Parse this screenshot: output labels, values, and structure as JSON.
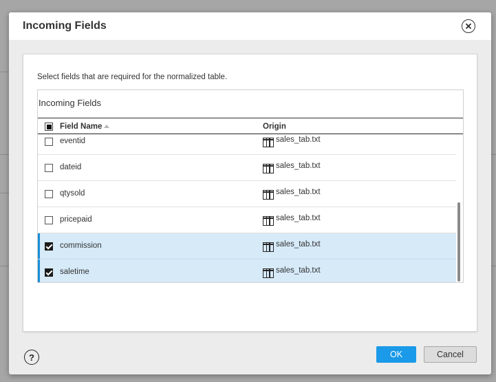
{
  "dialog": {
    "title": "Incoming Fields",
    "instructions": "Select fields that are required for the normalized table.",
    "ok_label": "OK",
    "cancel_label": "Cancel",
    "help_label": "?"
  },
  "grid": {
    "title": "Incoming Fields",
    "columns": {
      "field_name": "Field Name",
      "origin": "Origin"
    },
    "rows": [
      {
        "name": "eventid",
        "origin": "sales_tab.txt",
        "checked": false
      },
      {
        "name": "dateid",
        "origin": "sales_tab.txt",
        "checked": false
      },
      {
        "name": "qtysold",
        "origin": "sales_tab.txt",
        "checked": false
      },
      {
        "name": "pricepaid",
        "origin": "sales_tab.txt",
        "checked": false
      },
      {
        "name": "commission",
        "origin": "sales_tab.txt",
        "checked": true
      },
      {
        "name": "saletime",
        "origin": "sales_tab.txt",
        "checked": true
      }
    ]
  },
  "colors": {
    "accent": "#1a9ae8",
    "selected_row": "#d6eaf8",
    "selection_bar": "#1a8fd8"
  },
  "icons": {
    "close": "close-circle-icon",
    "help": "question-circle-icon",
    "sort": "sort-ascending-icon",
    "table": "table-icon"
  }
}
